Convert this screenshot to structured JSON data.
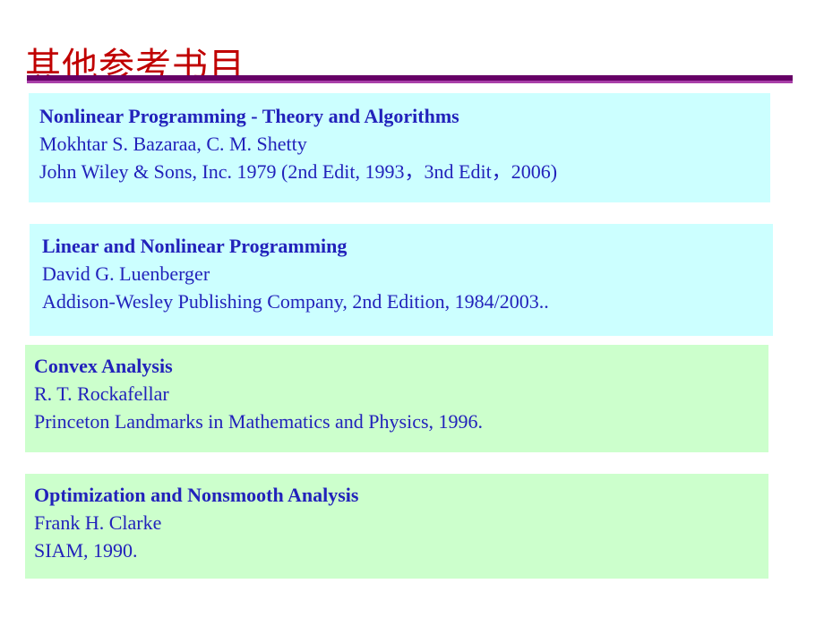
{
  "slide": {
    "title": "其他参考书目",
    "title_color": "#c00000",
    "background": "#ffffff",
    "divider": {
      "top_color": "#660066",
      "bottom_color": "#a83fa8"
    }
  },
  "references": [
    {
      "id": "ref-box-0",
      "background": "#ccffff",
      "theme": "cyan",
      "title": "Nonlinear Programming - Theory and Algorithms",
      "authors": "Mokhtar S. Bazaraa, C. M. Shetty",
      "publisher": "John Wiley & Sons, Inc. 1979 (2nd Edit, 1993，3nd Edit，2006)"
    },
    {
      "id": "ref-box-1",
      "background": "#ccffff",
      "theme": "cyan",
      "title": "Linear and Nonlinear Programming",
      "authors": "David G. Luenberger",
      "publisher": "Addison-Wesley Publishing Company, 2nd Edition, 1984/2003.."
    },
    {
      "id": "ref-box-2",
      "background": "#ccffcc",
      "theme": "green",
      "title": "Convex Analysis",
      "authors": "R. T. Rockafellar",
      "publisher": "Princeton Landmarks in Mathematics and Physics, 1996."
    },
    {
      "id": "ref-box-3",
      "background": "#ccffcc",
      "theme": "green",
      "title": "Optimization and Nonsmooth Analysis",
      "authors": "Frank H. Clarke",
      "publisher": "SIAM, 1990."
    }
  ]
}
